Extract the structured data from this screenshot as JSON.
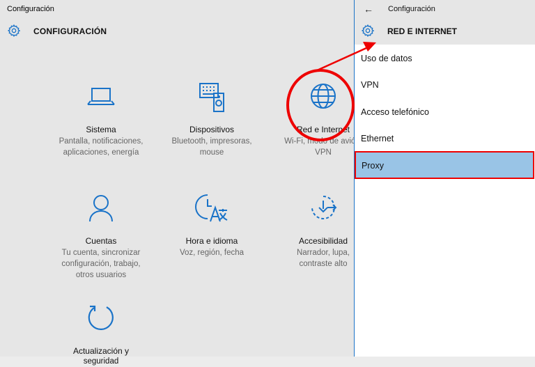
{
  "left_window": {
    "title": "Configuración",
    "header": "CONFIGURACIÓN",
    "tiles": [
      {
        "name": "Sistema",
        "desc": [
          "Pantalla, notificaciones,",
          "aplicaciones, energía"
        ],
        "icon": "laptop-icon"
      },
      {
        "name": "Dispositivos",
        "desc": [
          "Bluetooth, impresoras,",
          "mouse"
        ],
        "icon": "devices-icon"
      },
      {
        "name": "Red e Internet",
        "desc": [
          "Wi-Fi, modo de avión,",
          "VPN"
        ],
        "icon": "globe-icon"
      },
      {
        "name": "Cuentas",
        "desc": [
          "Tu cuenta, sincronizar",
          "configuración, trabajo,",
          "otros usuarios"
        ],
        "icon": "person-icon"
      },
      {
        "name": "Hora e idioma",
        "desc": [
          "Voz, región, fecha"
        ],
        "icon": "time-language-icon"
      },
      {
        "name": "Accesibilidad",
        "desc": [
          "Narrador, lupa,",
          "contraste alto"
        ],
        "icon": "accessibility-icon"
      },
      {
        "name": "Actualización y",
        "desc": [
          "seguridad"
        ],
        "icon": "update-icon"
      }
    ]
  },
  "right_panel": {
    "title": "Configuración",
    "header": "RED E INTERNET",
    "items": [
      "Uso de datos",
      "VPN",
      "Acceso telefónico",
      "Ethernet",
      "Proxy"
    ]
  },
  "colors": {
    "accent": "#1a73c8",
    "annotation": "#ee0000",
    "selected": "#99c4e6"
  }
}
